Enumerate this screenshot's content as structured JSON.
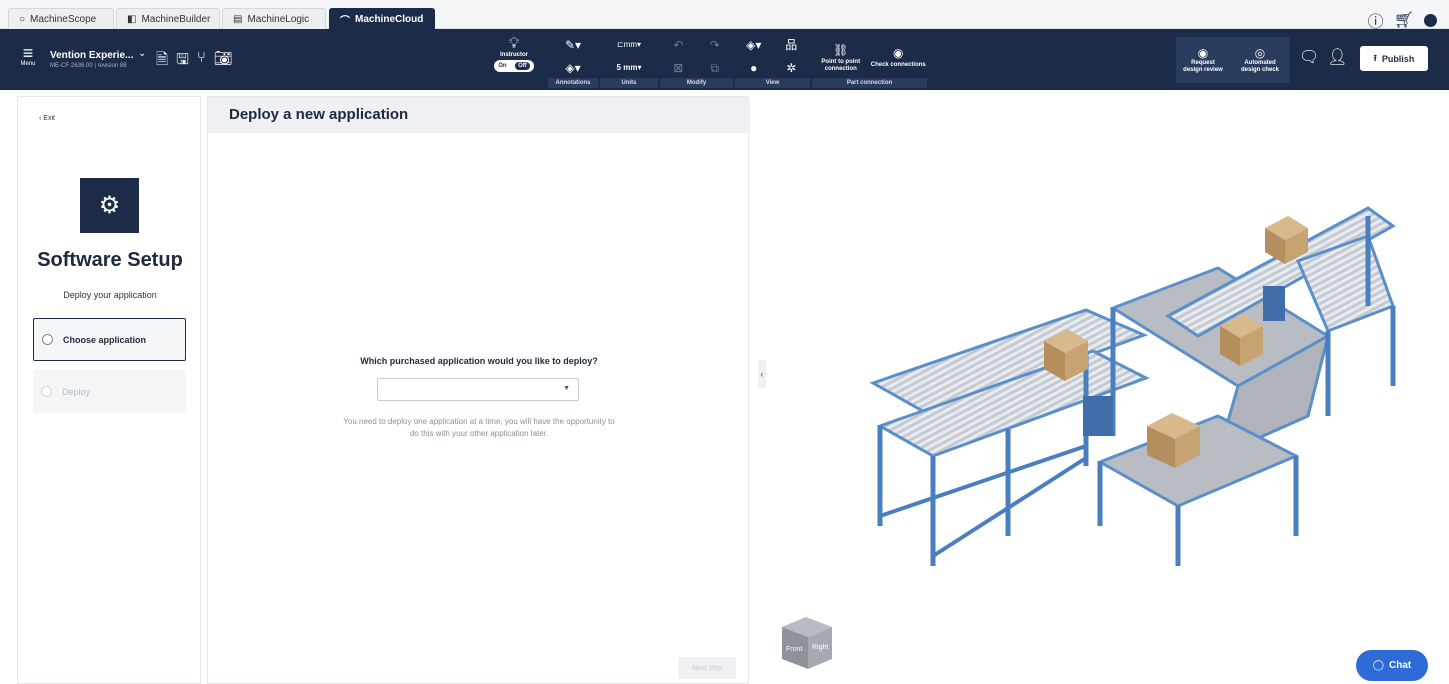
{
  "tabs": [
    {
      "label": "MachineScope",
      "icon": "circle-icon"
    },
    {
      "label": "MachineBuilder",
      "icon": "builder-icon"
    },
    {
      "label": "MachineLogic",
      "icon": "logic-icon"
    },
    {
      "label": "MachineCloud",
      "icon": "cloud-icon",
      "active": true
    }
  ],
  "toolbar": {
    "menu_label": "Menu",
    "project_name": "Vention Experie...",
    "project_sub": "ME-CF-2636.00 | revision 88",
    "instructor_label": "Instructor",
    "toggle_on": "On",
    "toggle_off": "Off",
    "units_value": "5 mm",
    "units_short": "mm",
    "groups": {
      "annotations": "Annotations",
      "units": "Units",
      "modify": "Modify",
      "view": "View",
      "part_connection": "Part connection"
    },
    "point_to_point": "Point to point connection",
    "check_connections": "Check connections",
    "request_review": "Request design review",
    "automated_check": "Automated design check",
    "publish_label": "Publish"
  },
  "sidebar": {
    "exit_label": "‹ Exit",
    "title": "Software Setup",
    "subtitle": "Deploy your application",
    "steps": [
      {
        "label": "Choose application",
        "state": "active"
      },
      {
        "label": "Deploy",
        "state": "disabled"
      }
    ]
  },
  "main": {
    "header": "Deploy a new application",
    "question": "Which purchased application would you like to deploy?",
    "select_value": "",
    "hint": "You need to deploy one application at a time, you will have the opportunity to do this with your other application later.",
    "next_label": "Next step"
  },
  "viewport": {
    "cube_front": "Front",
    "cube_right": "Right"
  },
  "chat_label": "Chat",
  "colors": {
    "navy": "#1c2b47",
    "accent_blue": "#2f6bd6",
    "frame_blue": "#5b8fc9"
  }
}
